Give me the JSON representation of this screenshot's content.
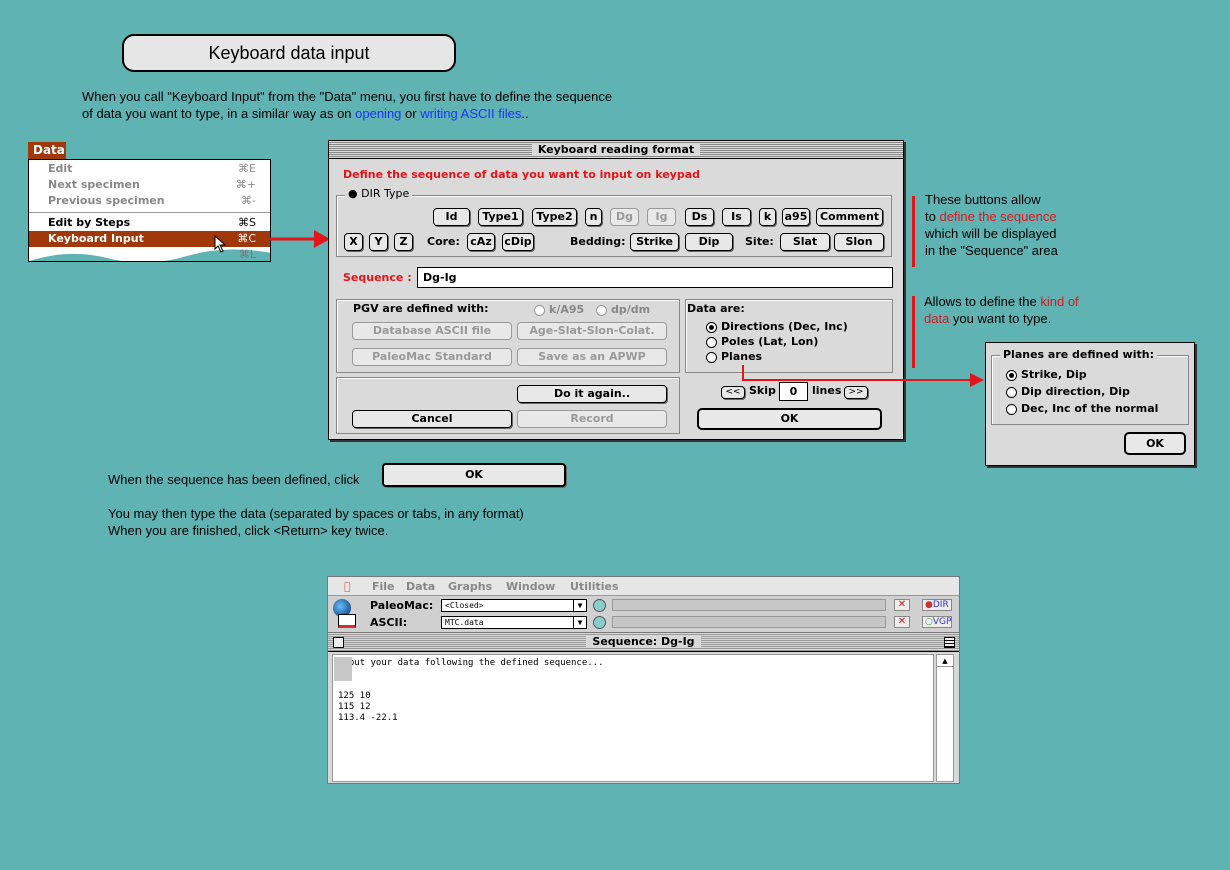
{
  "heading": "Keyboard data input",
  "intro": {
    "line1": "When you call \"Keyboard Input\" from the \"Data\" menu, you first have to define the sequence",
    "line2_a": "of data you want to type, in a similar way as on ",
    "link_opening": "opening",
    "line2_b": " or ",
    "link_writing": "writing ASCII files",
    "line2_c": ".."
  },
  "menu": {
    "title": "Data",
    "items": [
      {
        "label": "Edit",
        "key": "⌘E",
        "disabled": true
      },
      {
        "label": "Next specimen",
        "key": "⌘+",
        "disabled": true
      },
      {
        "label": "Previous specimen",
        "key": "⌘-",
        "disabled": true
      },
      {
        "label": "Edit by Steps",
        "key": "⌘S",
        "disabled": false
      },
      {
        "label": "Keyboard Input",
        "key": "⌘C",
        "disabled": false,
        "highlighted": true
      },
      {
        "label": "",
        "key": "⌘L",
        "disabled": true
      }
    ]
  },
  "dialog": {
    "title": "Keyboard reading format",
    "instruction": "Define the sequence of data you want to input on keypad",
    "group_label": "DIR Type",
    "row1": [
      "Id",
      "Type1",
      "Type2",
      "n",
      "Dg",
      "Ig",
      "Ds",
      "Is",
      "k",
      "a95",
      "Comment"
    ],
    "row1_disabled": [
      "Dg",
      "Ig"
    ],
    "row2_xyz": [
      "X",
      "Y",
      "Z"
    ],
    "core_label": "Core:",
    "core_buttons": [
      "cAz",
      "cDip"
    ],
    "bedding_label": "Bedding:",
    "bedding_buttons": [
      "Strike",
      "Dip"
    ],
    "site_label": "Site:",
    "site_buttons": [
      "Slat",
      "Slon"
    ],
    "sequence_label": "Sequence :",
    "sequence_value": "Dg-Ig",
    "pgv_label": "PGV are defined with:",
    "pgv_radio1": "k/A95",
    "pgv_radio2": "dp/dm",
    "pgv_btn1": "Database ASCII file",
    "pgv_btn2": "Age-Slat-Slon-Colat.",
    "pgv_btn3": "PaleoMac Standard",
    "pgv_btn4": "Save as an APWP",
    "data_are_label": "Data are:",
    "data_options": [
      "Directions (Dec, Inc)",
      "Poles (Lat, Lon)",
      "Planes"
    ],
    "data_selected": 0,
    "do_again": "Do it again..",
    "cancel": "Cancel",
    "record": "Record",
    "skip_prev": "<<",
    "skip_label": "Skip",
    "skip_value": "0",
    "lines_label": "lines",
    "skip_next": ">>",
    "ok": "OK"
  },
  "annotation1": {
    "line1": "These buttons allow",
    "line2_a": "to ",
    "line2_red": "define the sequence",
    "line3": "which will be displayed",
    "line4": "in the \"Sequence\" area"
  },
  "annotation2": {
    "line1_a": "Allows to define the ",
    "line1_red": "kind of",
    "line2_red": "data",
    "line2_b": " you want to type."
  },
  "planes_dialog": {
    "label": "Planes are defined with:",
    "options": [
      "Strike, Dip",
      "Dip direction, Dip",
      "Dec, Inc of the normal"
    ],
    "selected": 0,
    "ok": "OK"
  },
  "step_text": "When the sequence has been defined, click",
  "step_ok": "OK",
  "type_text1": "You may then type the data (separated by spaces or tabs, in any format)",
  "type_text2": "When you are finished, click <Return> key twice.",
  "app": {
    "menus": [
      "File",
      "Data",
      "Graphs",
      "Window",
      "Utilities"
    ],
    "paleomac_label": "PaleoMac:",
    "paleomac_value": "<Closed>",
    "ascii_label": "ASCII:",
    "ascii_value": "MTC.data",
    "tag_dir": "DIR",
    "tag_vgp": "VGP",
    "window_title": "Sequence:  Dg-Ig",
    "text_lines": [
      "Input your data following the defined sequence...",
      "",
      "",
      "125  10",
      "115  12",
      "113.4  -22.1"
    ]
  },
  "colors": {
    "background": "#5fb3b3",
    "accent": "#e3141a",
    "menu_highlight": "#a0380a",
    "link": "#1a33ff"
  }
}
